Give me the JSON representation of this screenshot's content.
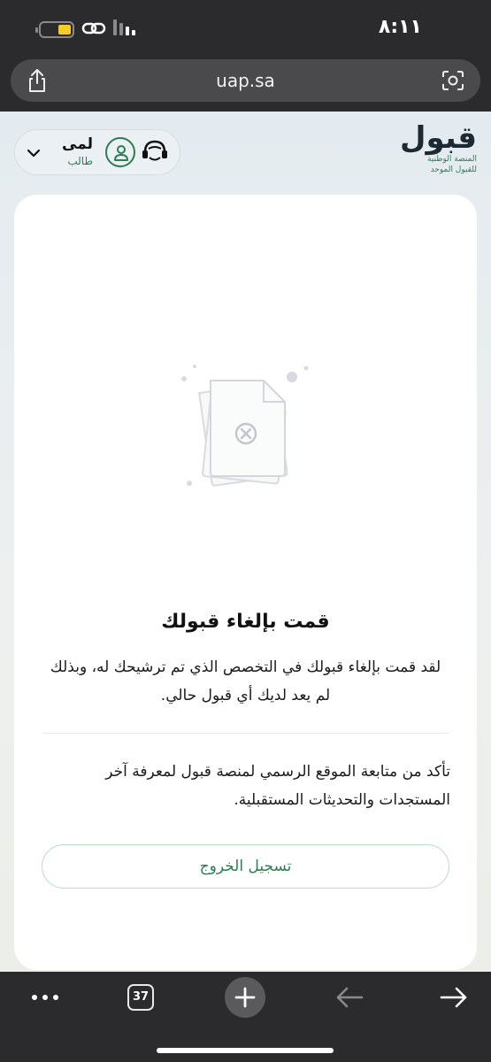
{
  "status_bar": {
    "time": "٨:١١"
  },
  "browser": {
    "url": "uap.sa",
    "tab_count": "37"
  },
  "header": {
    "logo_main": "قبول",
    "logo_sub_line1": "المنصة الوطنية",
    "logo_sub_line2": "للقبول الموحد",
    "user_name": "لمى",
    "user_role": "طالب"
  },
  "card": {
    "title": "قمت بإلغاء قبولك",
    "message": "لقد قمت بإلغاء قبولك في التخصص الذي تم ترشيحك له، وبذلك لم يعد لديك أي قبول حالي.",
    "note": "تأكد من متابعة الموقع الرسمي لمنصة قبول لمعرفة آخر المستجدات والتحديثات المستقبلية.",
    "logout_label": "تسجيل الخروج"
  },
  "colors": {
    "brand_green": "#2e7d4f",
    "dark_chrome": "#2b2b2d"
  }
}
